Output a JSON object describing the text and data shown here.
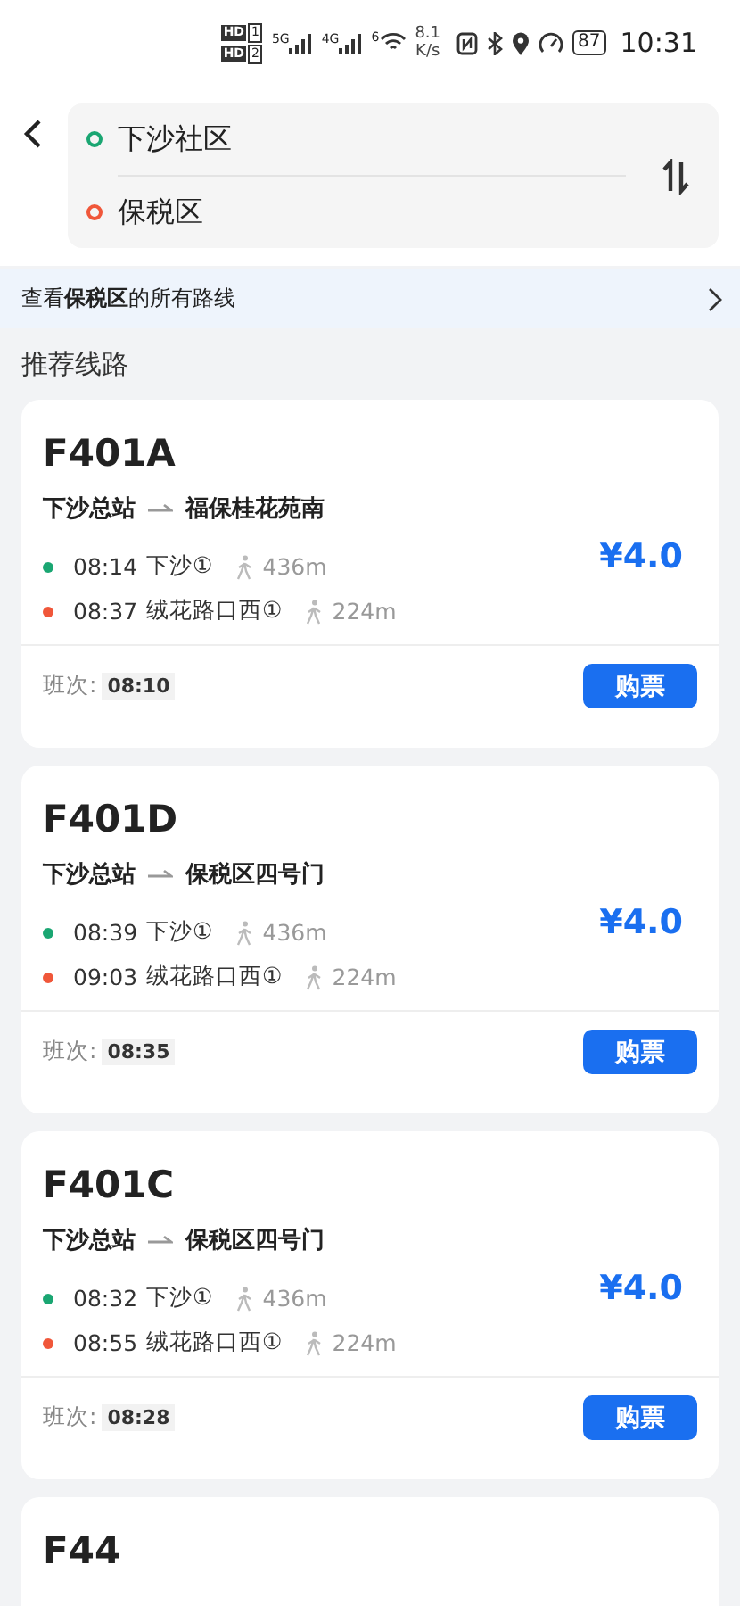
{
  "status_bar": {
    "sims": [
      {
        "badge": "HD",
        "slot": "1"
      },
      {
        "badge": "HD",
        "slot": "2"
      }
    ],
    "signals": [
      "5G",
      "4G"
    ],
    "wifi_label": "6",
    "speed_value": "8.1",
    "speed_unit": "K/s",
    "battery": "87",
    "time": "10:31"
  },
  "search": {
    "origin": "下沙社区",
    "destination": "保税区"
  },
  "banner": {
    "text": "查看**保税区**的所有路线"
  },
  "section_title": "推荐线路",
  "routes": [
    {
      "name": "F401A",
      "from": "下沙总站",
      "to": "福保桂花苑南",
      "price": "¥4.0",
      "stops": [
        {
          "time": "08:14",
          "stop": "下沙①",
          "walk": "436m",
          "color": "#1aa672"
        },
        {
          "time": "08:37",
          "stop": "绒花路口西①",
          "walk": "224m",
          "color": "#f0573a"
        }
      ],
      "schedule_label": "班次:",
      "schedule_time": "08:10",
      "button": "购票"
    },
    {
      "name": "F401D",
      "from": "下沙总站",
      "to": "保税区四号门",
      "price": "¥4.0",
      "stops": [
        {
          "time": "08:39",
          "stop": "下沙①",
          "walk": "436m",
          "color": "#1aa672"
        },
        {
          "time": "09:03",
          "stop": "绒花路口西①",
          "walk": "224m",
          "color": "#f0573a"
        }
      ],
      "schedule_label": "班次:",
      "schedule_time": "08:35",
      "button": "购票"
    },
    {
      "name": "F401C",
      "from": "下沙总站",
      "to": "保税区四号门",
      "price": "¥4.0",
      "stops": [
        {
          "time": "08:32",
          "stop": "下沙①",
          "walk": "436m",
          "color": "#1aa672"
        },
        {
          "time": "08:55",
          "stop": "绒花路口西①",
          "walk": "224m",
          "color": "#f0573a"
        }
      ],
      "schedule_label": "班次:",
      "schedule_time": "08:28",
      "button": "购票"
    },
    {
      "name": "F44"
    }
  ]
}
